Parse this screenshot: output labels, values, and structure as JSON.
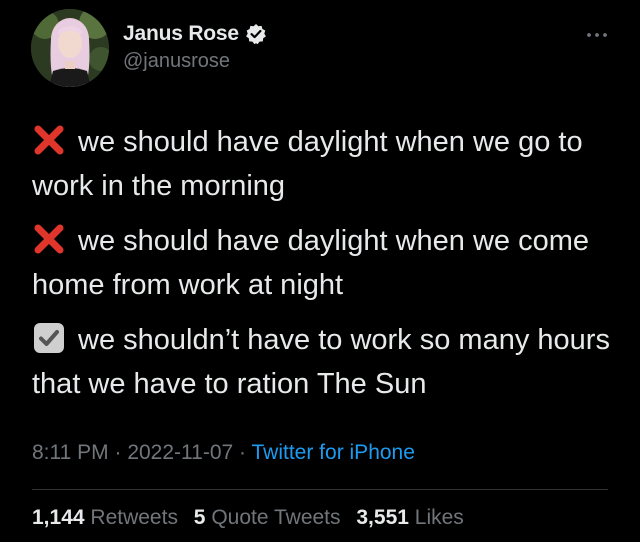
{
  "author": {
    "display_name": "Janus Rose",
    "handle": "@janusrose",
    "verified": true
  },
  "icons": {
    "verified": "verified-badge-icon",
    "more": "more-options-icon",
    "cross": "cross-mark-emoji",
    "check": "check-box-emoji"
  },
  "tweet": {
    "lines": [
      {
        "emoji": "cross",
        "text": "we should have daylight when we go to work in the morning"
      },
      {
        "emoji": "cross",
        "text": "we should have daylight when we come home from work at night"
      },
      {
        "emoji": "check",
        "text": "we shouldn’t have to work so many hours that we have to ration The Sun"
      }
    ]
  },
  "meta": {
    "time": "8:11 PM",
    "separator": " · ",
    "date": "2022-11-07",
    "source": "Twitter for iPhone"
  },
  "stats": {
    "retweets_count": "1,144",
    "retweets_label": "Retweets",
    "quotes_count": "5",
    "quotes_label": "Quote Tweets",
    "likes_count": "3,551",
    "likes_label": "Likes"
  },
  "colors": {
    "background": "#000000",
    "text": "#e7e9ea",
    "secondary": "#71767b",
    "link": "#1d9bf0",
    "cross": "#e0352b",
    "check_box": "#cfcfcf"
  }
}
